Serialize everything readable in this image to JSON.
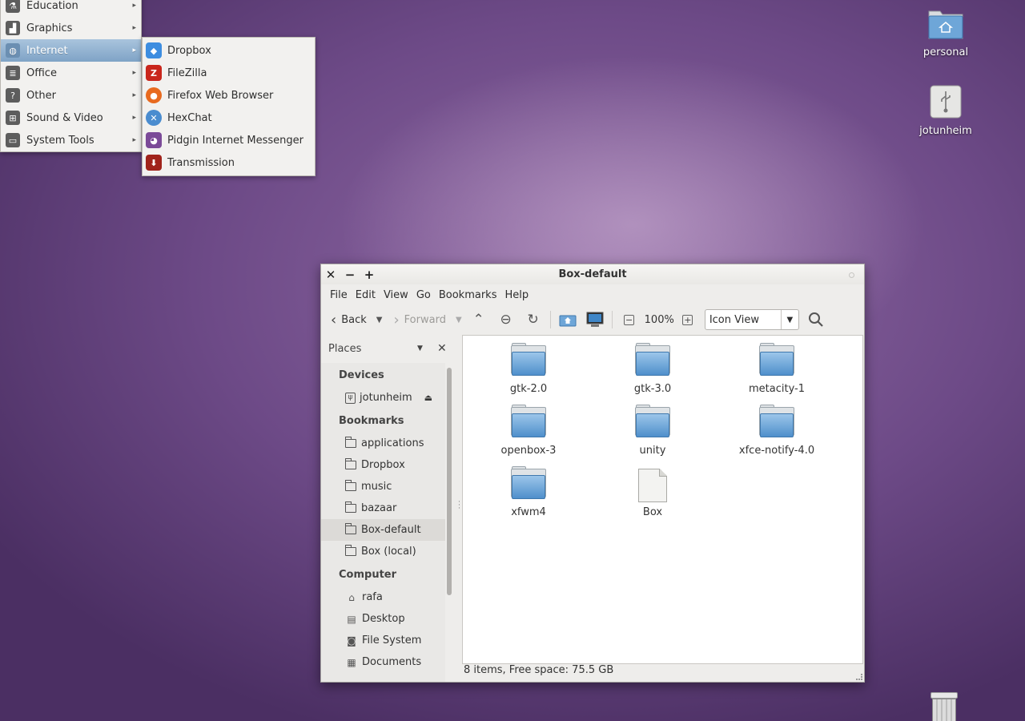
{
  "app_menu": {
    "items": [
      {
        "label": "Education",
        "icon": "flask-icon"
      },
      {
        "label": "Graphics",
        "icon": "chart-icon"
      },
      {
        "label": "Internet",
        "icon": "globe-icon"
      },
      {
        "label": "Office",
        "icon": "document-icon"
      },
      {
        "label": "Other",
        "icon": "question-icon"
      },
      {
        "label": "Sound & Video",
        "icon": "mixer-icon"
      },
      {
        "label": "System Tools",
        "icon": "monitor-icon"
      }
    ],
    "active": "Internet",
    "submenu": [
      {
        "label": "Dropbox",
        "icon": "dropbox-icon",
        "color": "#3d8de0"
      },
      {
        "label": "FileZilla",
        "icon": "filezilla-icon",
        "color": "#c9261c"
      },
      {
        "label": "Firefox Web Browser",
        "icon": "firefox-icon",
        "color": "#e86a1f"
      },
      {
        "label": "HexChat",
        "icon": "hexchat-icon",
        "color": "#4a8ccf"
      },
      {
        "label": "Pidgin Internet Messenger",
        "icon": "pidgin-icon",
        "color": "#7b4a98"
      },
      {
        "label": "Transmission",
        "icon": "transmission-icon",
        "color": "#a0231b"
      }
    ]
  },
  "desktop": {
    "icons": [
      {
        "label": "personal",
        "icon": "home-folder-icon"
      },
      {
        "label": "jotunheim",
        "icon": "usb-drive-icon"
      }
    ]
  },
  "window": {
    "title": "Box-default",
    "menubar": [
      "File",
      "Edit",
      "View",
      "Go",
      "Bookmarks",
      "Help"
    ],
    "toolbar": {
      "back_label": "Back",
      "forward_label": "Forward",
      "zoom": "100%",
      "view_mode": "Icon View"
    },
    "sidebar": {
      "title": "Places",
      "sections": {
        "devices": "Devices",
        "bookmarks": "Bookmarks",
        "computer": "Computer"
      },
      "devices": [
        "jotunheim"
      ],
      "bookmarks": [
        "applications",
        "Dropbox",
        "music",
        "bazaar",
        "Box-default",
        "Box (local)"
      ],
      "selected": "Box-default",
      "computer": [
        "rafa",
        "Desktop",
        "File System",
        "Documents"
      ]
    },
    "files": [
      {
        "name": "gtk-2.0",
        "type": "folder"
      },
      {
        "name": "gtk-3.0",
        "type": "folder"
      },
      {
        "name": "metacity-1",
        "type": "folder"
      },
      {
        "name": "openbox-3",
        "type": "folder"
      },
      {
        "name": "unity",
        "type": "folder"
      },
      {
        "name": "xfce-notify-4.0",
        "type": "folder"
      },
      {
        "name": "xfwm4",
        "type": "folder"
      },
      {
        "name": "Box",
        "type": "file"
      }
    ],
    "status": "8 items, Free space: 75.5 GB"
  }
}
